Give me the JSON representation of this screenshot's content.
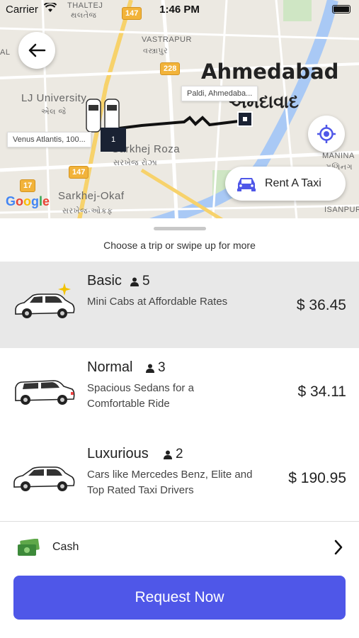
{
  "status_bar": {
    "carrier": "Carrier",
    "time": "1:46 PM"
  },
  "map": {
    "city": "Ahmedabad",
    "city_gujarati": "અમદાવાદ",
    "labels": {
      "thaltej": "THALTEJ",
      "thaltej_guj": "થલતેજ",
      "vastrapur": "VASTRAPUR",
      "vastrapur_guj": "વસ્ત્રાપુર",
      "lj_university": "LJ University",
      "lj_guj": "એલ જે",
      "sarkhej_roza": "Sarkhej Roza",
      "sarkhej_roza_guj": "સરખેજ રોઝા",
      "sarkhej_okaf": "Sarkhej-Okaf",
      "sarkhej_okaf_guj": "સરખેજ-ઓકફ",
      "manina": "MANINA",
      "manina_guj": "મણિનગ",
      "isanpur": "ISANPUR",
      "al": "AL"
    },
    "road_shields": [
      "147",
      "228",
      "147",
      "17"
    ],
    "origin_label": "Venus Atlantis, 100...",
    "origin_count": "1",
    "destination_label": "Paldi, Ahmedaba...",
    "google": "Google",
    "rent_button_label": "Rent A Taxi"
  },
  "sheet": {
    "hint": "Choose a trip or swipe up for more",
    "trips": [
      {
        "name": "Basic",
        "seats": "5",
        "description": "Mini Cabs at Affordable Rates",
        "price": "$ 36.45",
        "selected": true
      },
      {
        "name": "Normal",
        "seats": "3",
        "description": "Spacious Sedans for a Comfortable Ride",
        "price": "$ 34.11",
        "selected": false
      },
      {
        "name": "Luxurious",
        "seats": "2",
        "description": "Cars like Mercedes Benz, Elite and Top Rated Taxi Drivers",
        "price": "$ 190.95",
        "selected": false
      }
    ],
    "payment_method": "Cash",
    "request_button": "Request Now"
  },
  "colors": {
    "accent": "#4f57e8",
    "selected_row": "#e8e8e8",
    "route": "#111111",
    "sparkle": "#f2c200"
  }
}
